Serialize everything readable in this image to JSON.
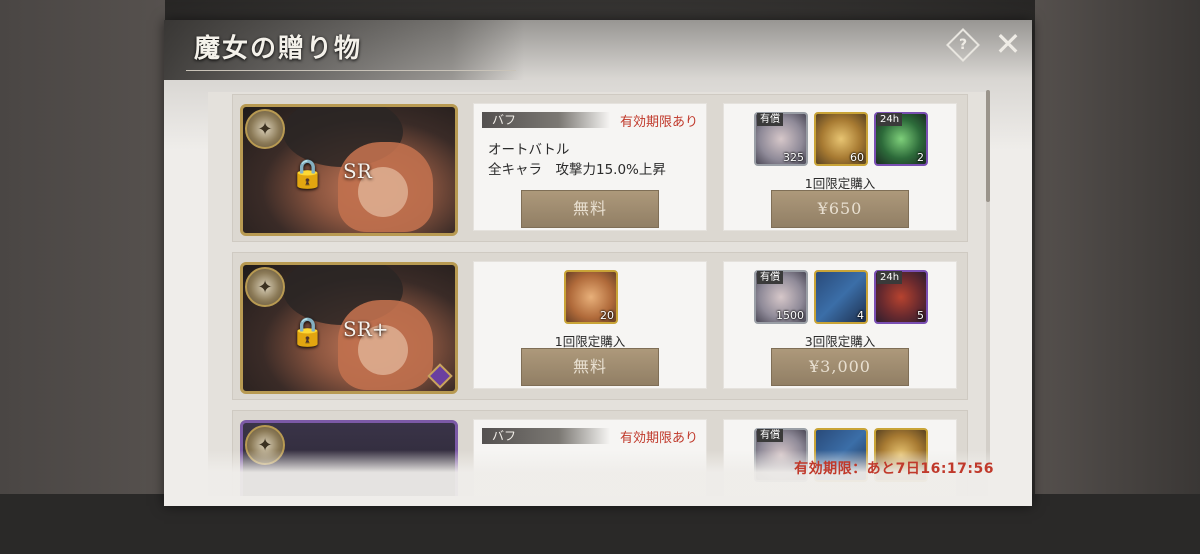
{
  "dialog": {
    "title": "魔女の贈り物",
    "help_icon": "help-diamond-icon",
    "close_icon": "close-icon",
    "expiry": "有効期限：あと7日16:17:56"
  },
  "colors": {
    "accent_red": "#c0392b",
    "gold_frame": "#b89a52",
    "purple_frame": "#7c5aa6"
  },
  "rows": [
    {
      "rarity": "SR",
      "mid": {
        "buff_label": "バフ",
        "validity": "有効期限あり",
        "desc_line1": "オートバトル",
        "desc_line2": "全キャラ　攻撃力15.0%上昇",
        "button": "無料"
      },
      "right": {
        "items": [
          {
            "tag": "有償",
            "count": "325"
          },
          {
            "tag": "",
            "count": "60"
          },
          {
            "tag": "24h",
            "count": "2"
          }
        ],
        "limit": "1回限定購入",
        "button": "¥650"
      }
    },
    {
      "rarity": "SR+",
      "mid": {
        "ticket_count": "20",
        "limit": "1回限定購入",
        "button": "無料"
      },
      "right": {
        "items": [
          {
            "tag": "有償",
            "count": "1500"
          },
          {
            "tag": "",
            "count": "4"
          },
          {
            "tag": "24h",
            "count": "5"
          }
        ],
        "limit": "3回限定購入",
        "button": "¥3,000"
      }
    },
    {
      "mid": {
        "buff_label": "バフ",
        "validity": "有効期限あり"
      },
      "right": {
        "items": [
          {
            "tag": "有償"
          }
        ]
      }
    }
  ]
}
